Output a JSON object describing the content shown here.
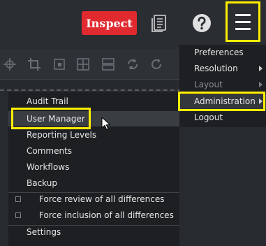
{
  "header": {
    "inspect_label": "Inspect",
    "report_icon": "report-document-icon",
    "help_icon": "help-circle-icon",
    "menu_icon": "hamburger-menu-icon"
  },
  "toolbar": {
    "icons": [
      "crosshair-icon",
      "crop-icon",
      "region-icon",
      "grid-icon",
      "layers-icon",
      "refresh-icon",
      "reload-icon"
    ]
  },
  "main_menu": {
    "items": [
      {
        "label": "Preferences",
        "has_submenu": false,
        "disabled": false
      },
      {
        "label": "Resolution",
        "has_submenu": true,
        "disabled": false
      },
      {
        "label": "Layout",
        "has_submenu": true,
        "disabled": true
      },
      {
        "label": "Administration",
        "has_submenu": true,
        "disabled": false,
        "active": true
      },
      {
        "label": "Logout",
        "has_submenu": false,
        "disabled": false
      }
    ]
  },
  "admin_submenu": {
    "items": [
      {
        "label": "Audit Trail"
      },
      {
        "label": "User Manager",
        "hovered": true
      },
      {
        "label": "Reporting Levels"
      },
      {
        "label": "Comments"
      },
      {
        "label": "Workflows"
      },
      {
        "label": "Backup"
      }
    ],
    "checks": [
      {
        "label": "Force review of all differences",
        "checked": false
      },
      {
        "label": "Force inclusion of all differences",
        "checked": false
      }
    ],
    "settings_label": "Settings"
  },
  "colors": {
    "highlight": "#ffee00",
    "inspect_button": "#e12a30",
    "menu_background": "#1d1f22",
    "app_background": "#272a2e"
  }
}
